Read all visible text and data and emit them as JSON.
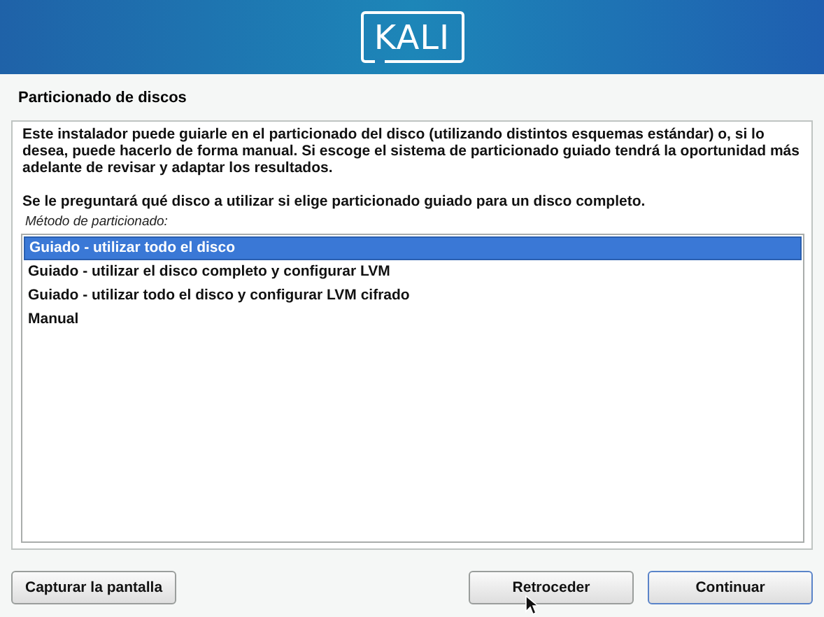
{
  "banner": {
    "logo": "KALI"
  },
  "title": "Particionado de discos",
  "description": [
    "Este instalador puede guiarle en el particionado del disco (utilizando distintos esquemas estándar) o, si lo desea, puede hacerlo de forma manual. Si escoge el sistema de particionado guiado tendrá la oportunidad más adelante de revisar y adaptar los resultados.",
    "Se le preguntará qué disco a utilizar si elige particionado guiado para un disco completo."
  ],
  "list_label": "Método de particionado:",
  "options": [
    {
      "label": "Guiado - utilizar todo el disco",
      "selected": true
    },
    {
      "label": "Guiado - utilizar el disco completo y configurar LVM",
      "selected": false
    },
    {
      "label": "Guiado - utilizar todo el disco y configurar LVM cifrado",
      "selected": false
    },
    {
      "label": "Manual",
      "selected": false
    }
  ],
  "buttons": [
    {
      "label": "Capturar la pantalla",
      "kind": "left",
      "focused": false
    },
    {
      "label": "Retroceder",
      "kind": "right",
      "focused": false
    },
    {
      "label": "Continuar",
      "kind": "right",
      "focused": true
    }
  ]
}
